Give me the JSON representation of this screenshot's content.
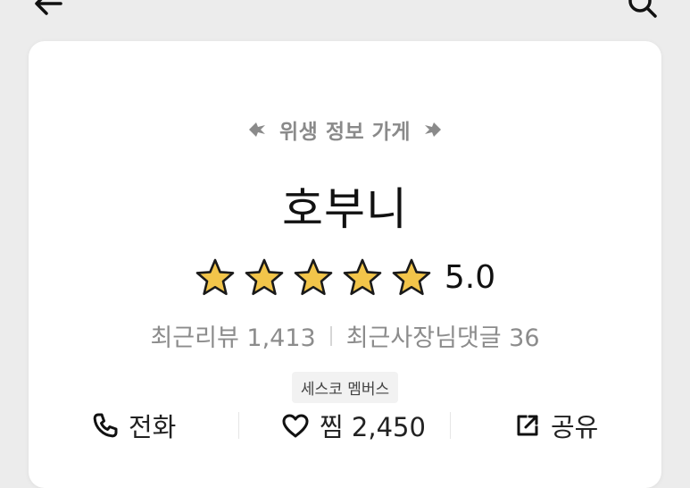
{
  "header": {
    "back_icon": "arrow-left-icon",
    "search_icon": "search-icon"
  },
  "store": {
    "hygiene_label": "위생 정보 가게",
    "name": "호부니",
    "rating": 5.0,
    "rating_text": "5.0",
    "stars": 5,
    "recent_reviews": "최근리뷰 1,413",
    "owner_replies": "최근사장님댓글 36",
    "badge": "세스코 멤버스"
  },
  "actions": {
    "call_label": "전화",
    "like_label": "찜 2,450",
    "share_label": "공유"
  },
  "colors": {
    "star_fill": "#f2c54a",
    "star_stroke": "#1a1a1a",
    "muted_text": "#8c8c8c",
    "leaf": "#8a8a8a"
  }
}
